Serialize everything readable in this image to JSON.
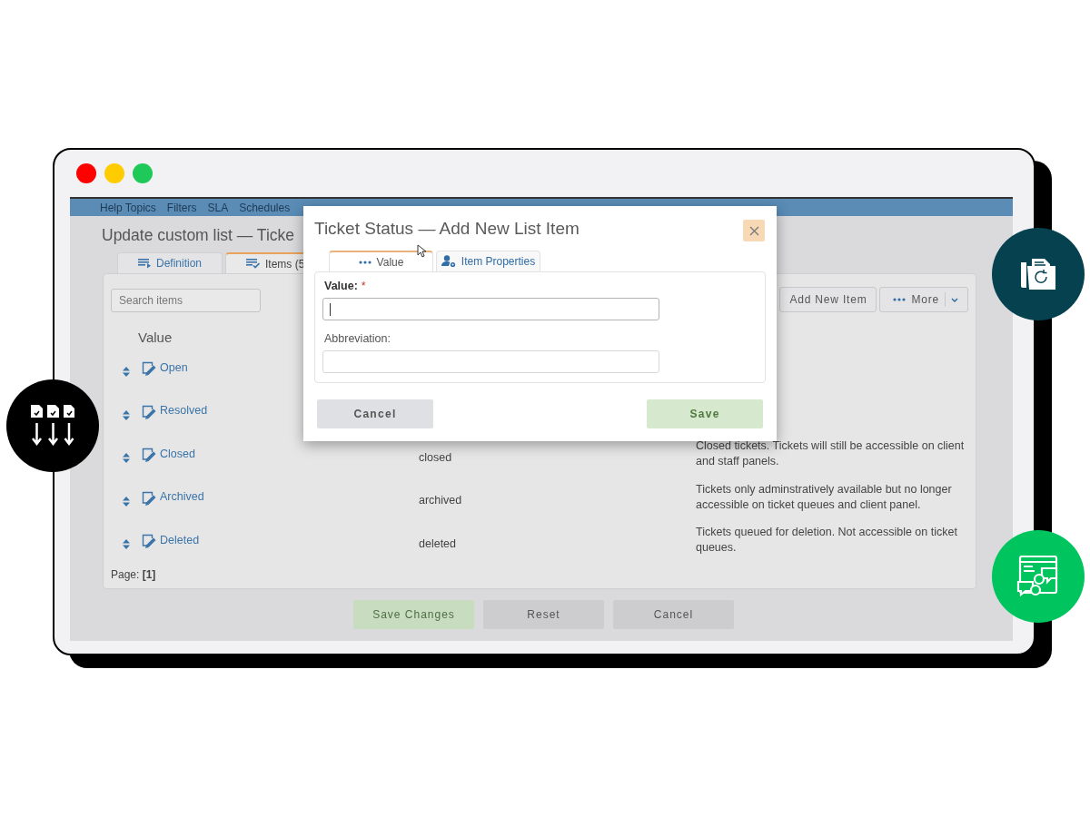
{
  "window": {
    "controls": [
      {
        "color": "#ff0000"
      },
      {
        "color": "#ffcc00"
      },
      {
        "color": "#1ec95a"
      }
    ]
  },
  "nav": [
    "Help Topics",
    "Filters",
    "SLA",
    "Schedules"
  ],
  "page": {
    "title": "Update custom list — Ticke",
    "tabs": [
      {
        "label": "Definition",
        "selected": false
      },
      {
        "label": "Items (5",
        "selected": true
      }
    ]
  },
  "search": {
    "placeholder": "Search items"
  },
  "toolbar": {
    "add": "Add New Item",
    "more": "More"
  },
  "table": {
    "columns": [
      "Value"
    ],
    "rows": [
      {
        "value": "Open"
      },
      {
        "value": "Resolved"
      },
      {
        "value": "Closed",
        "abbreviation": "closed",
        "description": "Closed tickets. Tickets will still be accessible on client and staff panels."
      },
      {
        "value": "Archived",
        "abbreviation": "archived",
        "description": "Tickets only adminstratively available but no longer accessible on ticket queues and client panel."
      },
      {
        "value": "Deleted",
        "abbreviation": "deleted",
        "description": "Tickets queued for deletion. Not accessible on ticket queues."
      }
    ]
  },
  "pager": "Page: **[1]**",
  "actions": [
    {
      "label": "Save Changes",
      "kind": "primary"
    },
    {
      "label": "Reset",
      "kind": "secondary"
    },
    {
      "label": "Cancel",
      "kind": "secondary"
    }
  ],
  "modal": {
    "title": "Ticket Status — Add New List Item",
    "required_mark": "*",
    "tabs": [
      {
        "label": "Value",
        "selected": true
      },
      {
        "label": "Item Properties",
        "selected": false
      }
    ],
    "fields": [
      {
        "label": "Value:",
        "required": true,
        "focused": true
      },
      {
        "label": "Abbreviation:",
        "required": false,
        "focused": false
      }
    ],
    "buttons": [
      {
        "label": "Cancel",
        "kind": "secondary"
      },
      {
        "label": "Save",
        "kind": "primary"
      }
    ]
  }
}
